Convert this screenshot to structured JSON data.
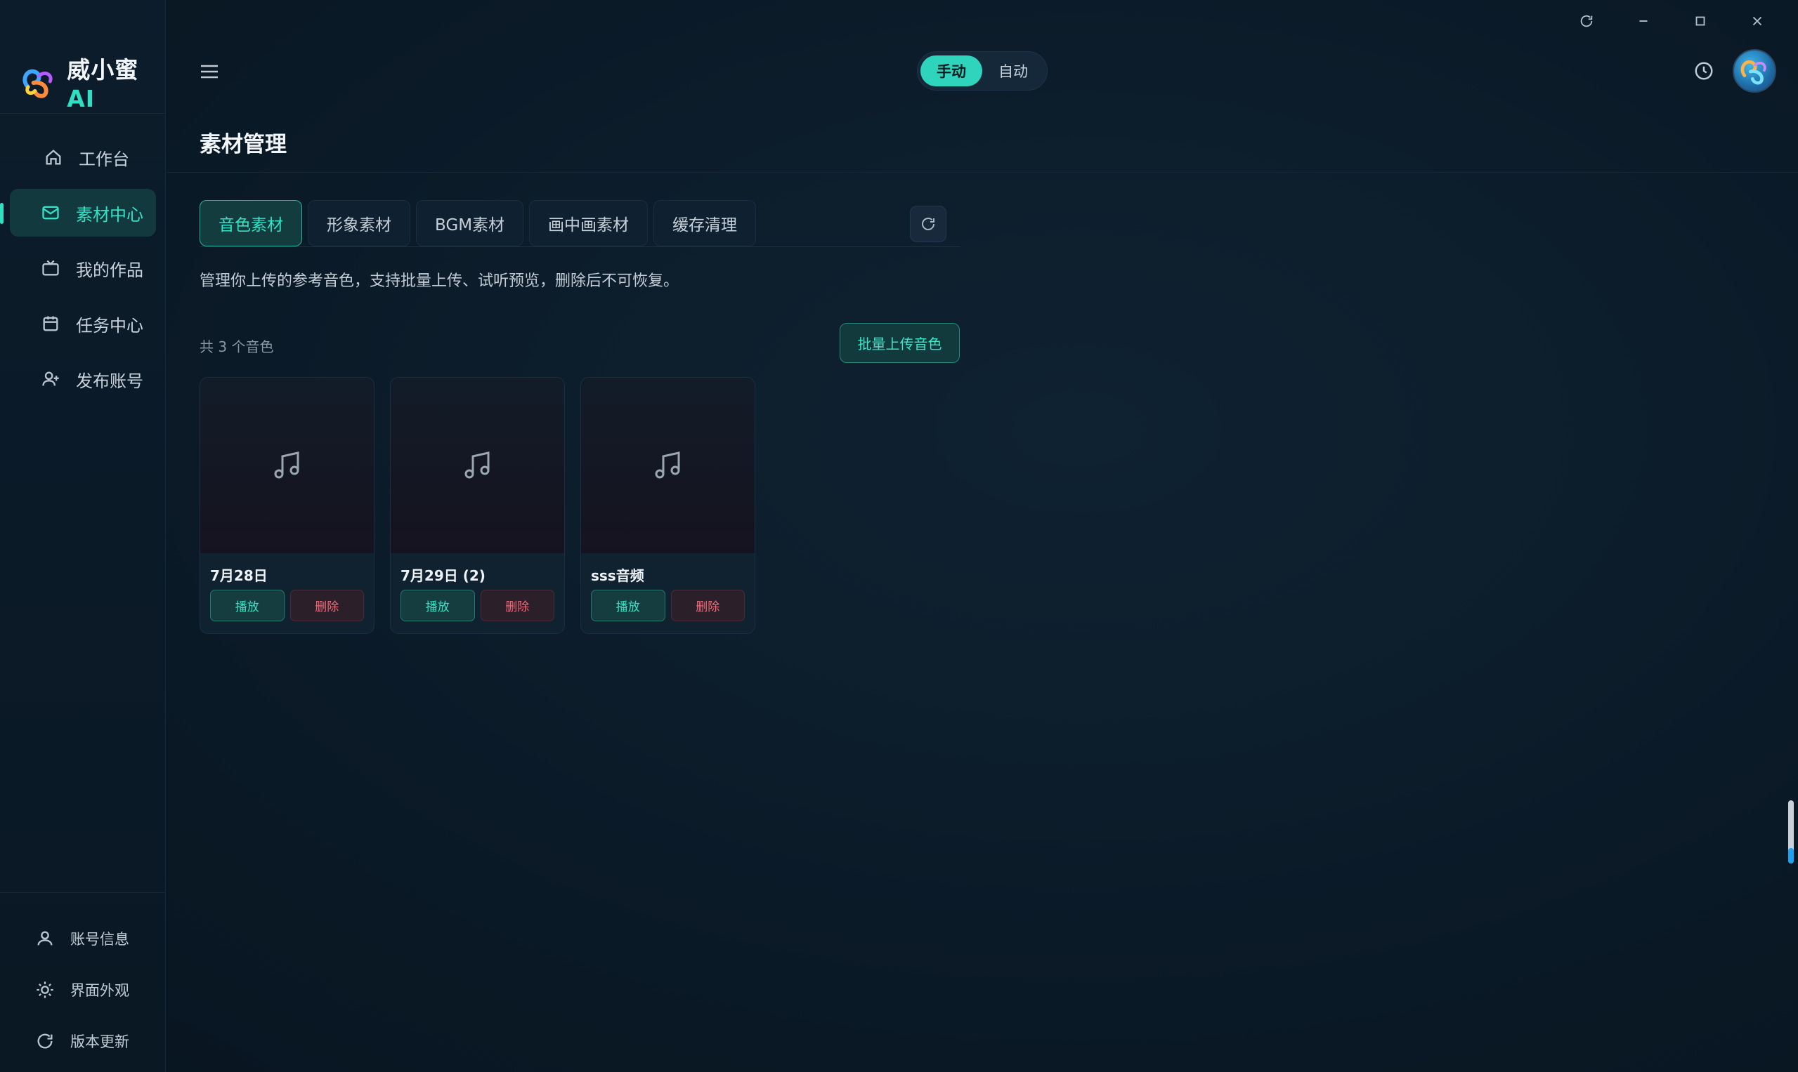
{
  "app": {
    "brand_name": "威小蜜",
    "brand_suffix": "AI"
  },
  "window_controls": [
    "refresh-icon",
    "minimize-icon",
    "maximize-icon",
    "close-icon"
  ],
  "sidebar": {
    "items": [
      {
        "label": "工作台",
        "icon": "home-icon",
        "active": false
      },
      {
        "label": "素材中心",
        "icon": "mail-icon",
        "active": true
      },
      {
        "label": "我的作品",
        "icon": "tv-icon",
        "active": false
      },
      {
        "label": "任务中心",
        "icon": "calendar-icon",
        "active": false
      },
      {
        "label": "发布账号",
        "icon": "user-plus-icon",
        "active": false
      }
    ],
    "bottom_items": [
      {
        "label": "账号信息",
        "icon": "user-icon"
      },
      {
        "label": "界面外观",
        "icon": "sun-icon"
      },
      {
        "label": "版本更新",
        "icon": "refresh-icon"
      }
    ]
  },
  "header": {
    "mode_options": [
      "手动",
      "自动"
    ],
    "mode_selected": "手动"
  },
  "page": {
    "title": "素材管理",
    "tabs": [
      {
        "label": "音色素材",
        "active": true
      },
      {
        "label": "形象素材",
        "active": false
      },
      {
        "label": "BGM素材",
        "active": false
      },
      {
        "label": "画中画素材",
        "active": false
      },
      {
        "label": "缓存清理",
        "active": false
      }
    ],
    "description": "管理你上传的参考音色，支持批量上传、试听预览，删除后不可恢复。",
    "count_text": "共 3 个音色",
    "upload_button": "批量上传音色"
  },
  "cards": [
    {
      "name": "7月28日",
      "play_label": "播放",
      "delete_label": "删除"
    },
    {
      "name": "7月29日 (2)",
      "play_label": "播放",
      "delete_label": "删除"
    },
    {
      "name": "sss音频",
      "play_label": "播放",
      "delete_label": "删除"
    }
  ],
  "colors": {
    "accent": "#2fe0c2",
    "danger": "#f06b7a",
    "background": "#0b1a27"
  }
}
